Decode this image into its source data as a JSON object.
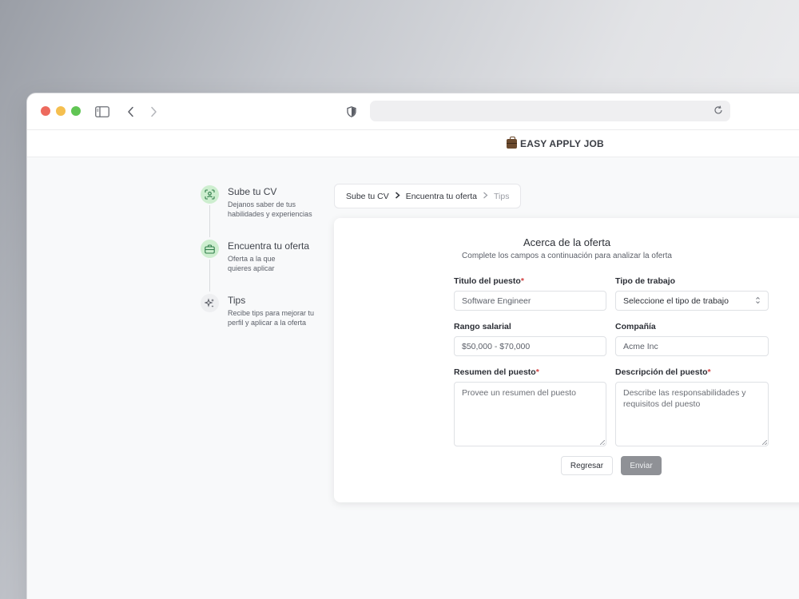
{
  "browser": {
    "url": ""
  },
  "app": {
    "brand": "EASY APPLY JOB"
  },
  "steps": [
    {
      "title": "Sube tu CV",
      "desc_line1": "Dejanos saber de tus",
      "desc_line2": "habilidades y experiencias",
      "icon": "scan-face-icon",
      "state": "done"
    },
    {
      "title": "Encuentra tu oferta",
      "desc_line1": "Oferta a la que",
      "desc_line2": "quieres aplicar",
      "icon": "briefcase-icon",
      "state": "done"
    },
    {
      "title": "Tips",
      "desc_line1": "Recibe tips para mejorar tu",
      "desc_line2": "perfil y aplicar a la oferta",
      "icon": "sparkles-icon",
      "state": "pending"
    }
  ],
  "breadcrumb": {
    "items": [
      "Sube tu CV",
      "Encuentra tu oferta",
      "Tips"
    ]
  },
  "form": {
    "title": "Acerca de la oferta",
    "subtitle": "Complete los campos a continuación para analizar la oferta",
    "job_title": {
      "label": "Titulo del puesto",
      "required": "*",
      "placeholder": "Software Engineer"
    },
    "job_type": {
      "label": "Tipo de trabajo",
      "value": "Seleccione el tipo de trabajo"
    },
    "salary": {
      "label": "Rango salarial",
      "placeholder": "$50,000 - $70,000"
    },
    "company": {
      "label": "Compañía",
      "placeholder": "Acme Inc"
    },
    "summary": {
      "label": "Resumen del puesto",
      "required": "*",
      "placeholder": "Provee un resumen del puesto"
    },
    "description": {
      "label": "Descripción del puesto",
      "required": "*",
      "placeholder": "Describe las responsabilidades y requisitos del puesto"
    },
    "back_button": "Regresar",
    "submit_button": "Enviar"
  },
  "colors": {
    "step_done_bg": "#cdeecf",
    "required": "#d24141",
    "submit_disabled": "#8f9196"
  }
}
